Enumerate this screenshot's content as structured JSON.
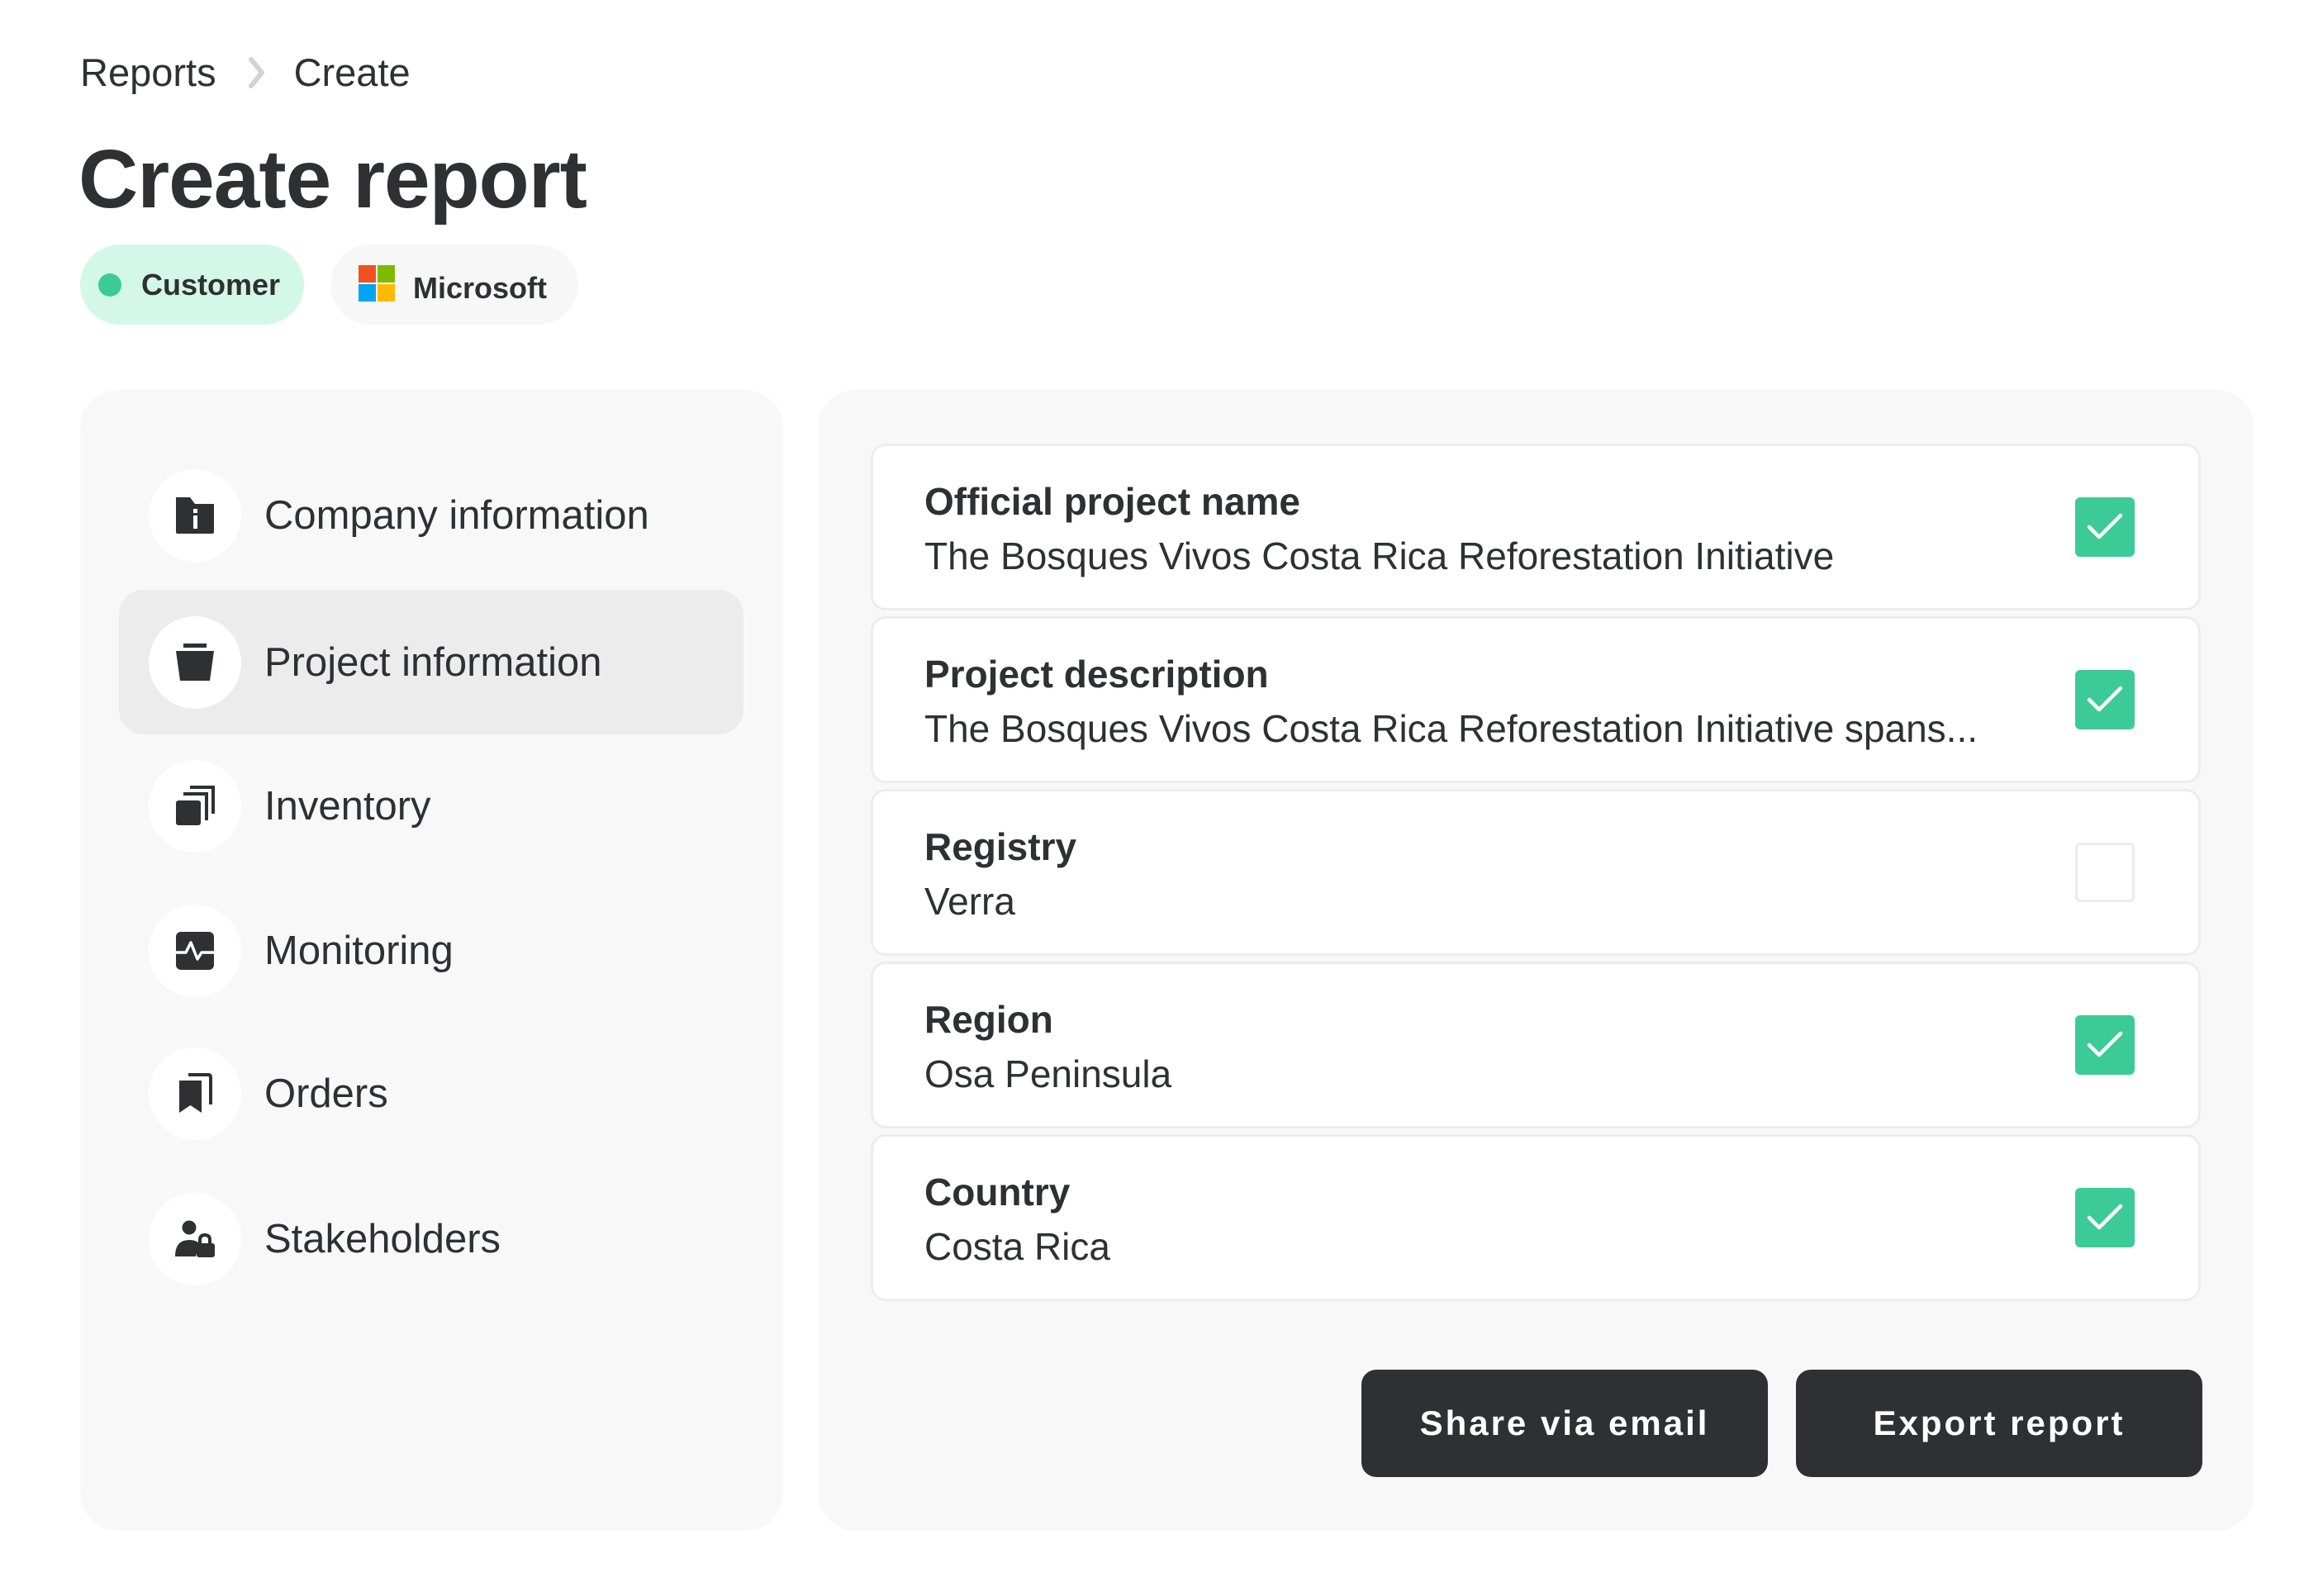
{
  "breadcrumb": {
    "items": [
      "Reports",
      "Create"
    ],
    "separator_icon": "chevron-right-icon"
  },
  "header": {
    "title": "Create report",
    "chips": [
      {
        "label": "Customer",
        "icon": "status-dot-icon",
        "dot_color": "#3ccb96",
        "bg_color": "#d4f8e7"
      },
      {
        "label": "Microsoft",
        "icon": "microsoft-logo-icon",
        "logo_colors": [
          "#f25022",
          "#7fba00",
          "#00a4ef",
          "#ffb900"
        ]
      }
    ]
  },
  "sidebar": {
    "items": [
      {
        "label": "Company information",
        "icon": "folder-info-icon",
        "active": false
      },
      {
        "label": "Project information",
        "icon": "bucket-icon",
        "active": true
      },
      {
        "label": "Inventory",
        "icon": "stacked-layers-icon",
        "active": false
      },
      {
        "label": "Monitoring",
        "icon": "activity-pulse-icon",
        "active": false
      },
      {
        "label": "Orders",
        "icon": "bookmarks-icon",
        "active": false
      },
      {
        "label": "Stakeholders",
        "icon": "user-lock-icon",
        "active": false
      }
    ]
  },
  "fields": [
    {
      "label": "Official project name",
      "value": "The Bosques Vivos Costa Rica Reforestation Initiative",
      "checked": true
    },
    {
      "label": "Project description",
      "value": "The Bosques Vivos Costa Rica Reforestation Initiative spans...",
      "checked": true
    },
    {
      "label": "Registry",
      "value": "Verra",
      "checked": false
    },
    {
      "label": "Region",
      "value": "Osa Peninsula",
      "checked": true
    },
    {
      "label": "Country",
      "value": "Costa Rica",
      "checked": true
    }
  ],
  "actions": {
    "share_label": "Share via email",
    "export_label": "Export report"
  },
  "colors": {
    "accent": "#3ccb96",
    "text": "#2f3033",
    "button_bg": "#2f3033",
    "panel_bg": "#f8f8f8"
  }
}
